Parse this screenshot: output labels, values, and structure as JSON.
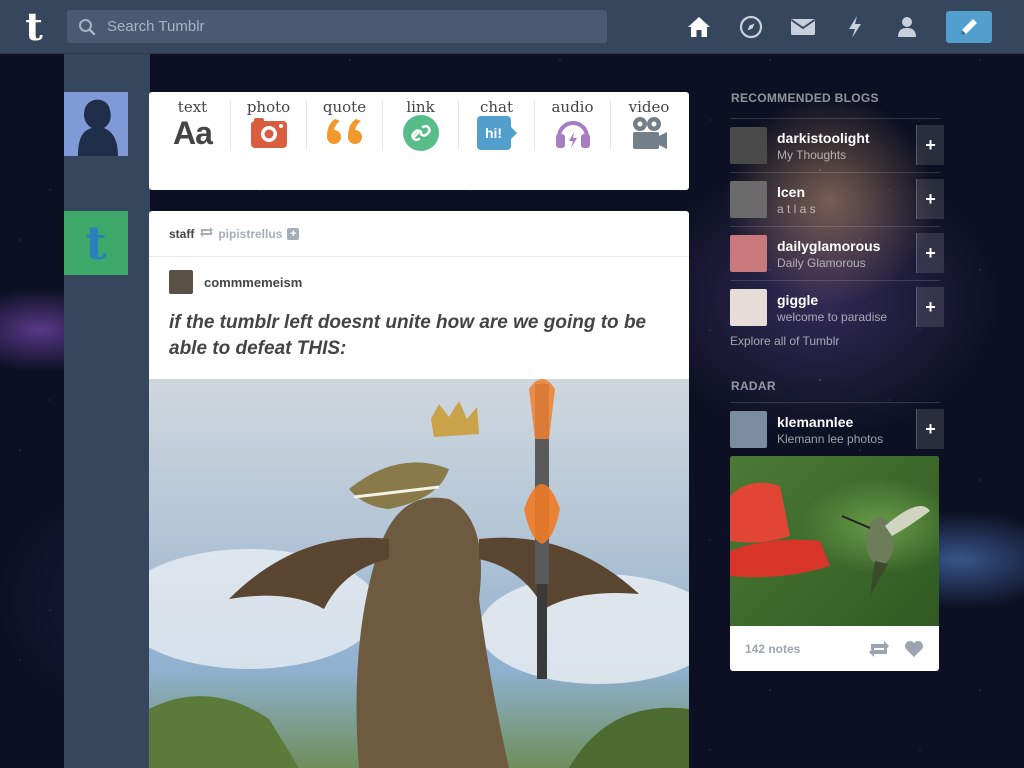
{
  "header": {
    "search_placeholder": "Search Tumblr",
    "nav": [
      "home-icon",
      "explore-compass-icon",
      "inbox-mail-icon",
      "activity-lightning-icon",
      "account-person-icon"
    ],
    "compose_icon": "pencil-icon"
  },
  "post_types": [
    {
      "label": "text",
      "icon": "Aa"
    },
    {
      "label": "photo",
      "icon": "camera-icon"
    },
    {
      "label": "quote",
      "icon": "quote-icon"
    },
    {
      "label": "link",
      "icon": "link-icon"
    },
    {
      "label": "chat",
      "icon": "hi!"
    },
    {
      "label": "audio",
      "icon": "headphones-icon"
    },
    {
      "label": "video",
      "icon": "video-camera-icon"
    }
  ],
  "post": {
    "author": "staff",
    "reblogged_from": "pipistrellus",
    "follow_glyph": "+",
    "source_blog": "commmemeism",
    "text": "if the tumblr left doesnt unite how are we going to be able to defeat THIS:"
  },
  "sidebar": {
    "recommended_title": "RECOMMENDED BLOGS",
    "recommended": [
      {
        "name": "darkistoolight",
        "subtitle": "My Thoughts",
        "color": "#4a4a4a"
      },
      {
        "name": "lcen",
        "subtitle": "a t l a s",
        "color": "#6b6b6b"
      },
      {
        "name": "dailyglamorous",
        "subtitle": "Daily Glamorous",
        "color": "#c9797c"
      },
      {
        "name": "giggle",
        "subtitle": "welcome to paradise",
        "color": "#e8dcd8"
      }
    ],
    "follow_glyph": "+",
    "explore_link": "Explore all of Tumblr",
    "radar_title": "RADAR",
    "radar_blog": {
      "name": "klemannlee",
      "subtitle": "Klemann lee photos",
      "color": "#7a8da0"
    },
    "radar_notes": "142 notes"
  },
  "colors": {
    "topbar": "#36465d",
    "accent_blue": "#529ecc",
    "photo_red": "#d95e40",
    "quote_orange": "#f2992e",
    "link_green": "#56bc8a",
    "chat_blue": "#529ecc",
    "audio_purple": "#a77dc2",
    "video_gray": "#748089"
  }
}
